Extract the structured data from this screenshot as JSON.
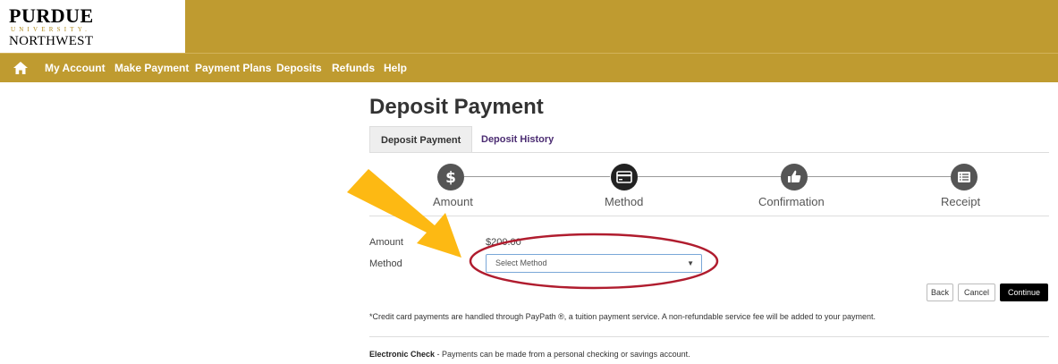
{
  "header": {
    "logo_line1": "PURDUE",
    "logo_line2": "UNIVERSITY.",
    "logo_line3": "NORTHWEST",
    "brand_color": "#bf9b30"
  },
  "nav": {
    "home_icon": "home-icon",
    "items": [
      "My Account",
      "Make Payment",
      "Payment Plans",
      "Deposits",
      "Refunds",
      "Help"
    ]
  },
  "page": {
    "title": "Deposit Payment",
    "tabs": [
      {
        "label": "Deposit Payment",
        "active": true
      },
      {
        "label": "Deposit History",
        "active": false
      }
    ]
  },
  "steps": [
    {
      "label": "Amount",
      "icon": "dollar-icon"
    },
    {
      "label": "Method",
      "icon": "credit-card-icon"
    },
    {
      "label": "Confirmation",
      "icon": "thumbs-up-icon"
    },
    {
      "label": "Receipt",
      "icon": "list-icon"
    }
  ],
  "form": {
    "amount_label": "Amount",
    "amount_value": "$200.00",
    "method_label": "Method",
    "method_placeholder": "Select Method"
  },
  "buttons": {
    "back": "Back",
    "cancel": "Cancel",
    "continue": "Continue"
  },
  "notes": {
    "credit_card": "*Credit card payments are handled through PayPath ®, a tuition payment service. A non-refundable service fee will be added to your payment.",
    "echeck_title": "Electronic Check",
    "echeck_text": " - Payments can be made from a personal checking or savings  account."
  },
  "annotations": {
    "arrow_color": "#fdb913",
    "ellipse_color": "#b01c2e"
  }
}
